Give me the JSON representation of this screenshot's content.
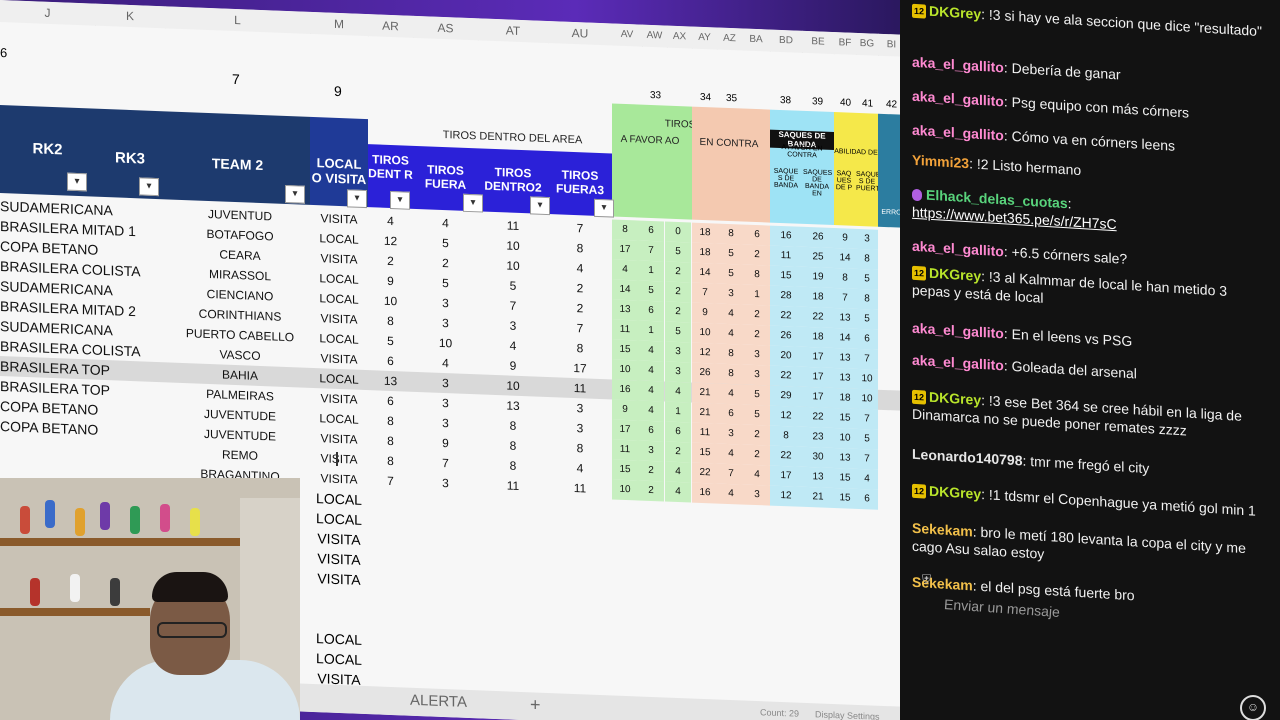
{
  "columns": {
    "J": "J",
    "K": "K",
    "L": "L",
    "M": "M",
    "AR": "AR",
    "AS": "AS",
    "AT": "AT",
    "AU": "AU",
    "AV": "AV",
    "AW": "AW",
    "AX": "AX",
    "AY": "AY",
    "AZ": "AZ",
    "BA": "BA",
    "BD": "BD",
    "BE": "BE",
    "BF": "BF",
    "BG": "BG",
    "BI": "BI"
  },
  "top_values": {
    "left": "6",
    "l": "7",
    "m": "9",
    "av": "33",
    "ay": "34",
    "az": "35",
    "bd": "38",
    "be": "39",
    "bf": "40",
    "bg": "41",
    "bi": "42"
  },
  "headers": {
    "rk2": "RK2",
    "rk3": "RK3",
    "team2": "TEAM 2",
    "local_visita": "LOCAL O VISITA",
    "tiros_dentro_area": "TIROS DENTRO DEL AREA",
    "tiros_dent": "TIROS DENT R",
    "tiros_fuera": "TIROS FUERA",
    "tiros_dentro2": "TIROS DENTRO2",
    "tiros_fuera3": "TIROS FUERA3",
    "tiros": "TIROS",
    "a_favor": "A FAVOR AO",
    "en_contra": "EN CONTRA",
    "saques_banda": "SAQUES DE BANDA",
    "a_favor_contra": "A FAVOR EN CONTRA",
    "habilidad": "ABILIDAD DE",
    "errores": "ERRO",
    "saques_sub": [
      "SAQUE S DE BANDA",
      "SAQUES DE BANDA EN",
      "SAQ UES DE P",
      "SAQUE S DE PUERT"
    ],
    "ti": "TI"
  },
  "rows": [
    {
      "rk2": "SUDAMERICANA",
      "team": "JUVENTUD",
      "lv": "VISITA",
      "a": "4",
      "b": "4",
      "c": "11",
      "d": "7",
      "g": [
        "8",
        "6",
        "0"
      ],
      "p": [
        "18",
        "8",
        "6"
      ],
      "s": [
        "16",
        "26",
        "9",
        "3"
      ]
    },
    {
      "rk2": "BRASILERA MITAD 1",
      "team": "BOTAFOGO",
      "lv": "LOCAL",
      "a": "12",
      "b": "5",
      "c": "10",
      "d": "8",
      "g": [
        "17",
        "7",
        "5"
      ],
      "p": [
        "18",
        "5",
        "2"
      ],
      "s": [
        "11",
        "25",
        "14",
        "8"
      ]
    },
    {
      "rk2": "COPA BETANO",
      "team": "CEARA",
      "lv": "VISITA",
      "a": "2",
      "b": "2",
      "c": "10",
      "d": "4",
      "g": [
        "4",
        "1",
        "2"
      ],
      "p": [
        "14",
        "5",
        "8"
      ],
      "s": [
        "15",
        "19",
        "8",
        "5"
      ]
    },
    {
      "rk2": "BRASILERA COLISTA",
      "team": "MIRASSOL",
      "lv": "LOCAL",
      "a": "9",
      "b": "5",
      "c": "5",
      "d": "2",
      "g": [
        "14",
        "5",
        "2"
      ],
      "p": [
        "7",
        "3",
        "1"
      ],
      "s": [
        "28",
        "18",
        "7",
        "8"
      ]
    },
    {
      "rk2": "SUDAMERICANA",
      "team": "CIENCIANO",
      "lv": "LOCAL",
      "a": "10",
      "b": "3",
      "c": "7",
      "d": "2",
      "g": [
        "13",
        "6",
        "2"
      ],
      "p": [
        "9",
        "4",
        "2"
      ],
      "s": [
        "22",
        "22",
        "13",
        "5"
      ]
    },
    {
      "rk2": "BRASILERA MITAD 2",
      "team": "CORINTHIANS",
      "lv": "VISITA",
      "a": "8",
      "b": "3",
      "c": "3",
      "d": "7",
      "g": [
        "11",
        "1",
        "5"
      ],
      "p": [
        "10",
        "4",
        "2"
      ],
      "s": [
        "26",
        "18",
        "14",
        "6"
      ]
    },
    {
      "rk2": "SUDAMERICANA",
      "team": "PUERTO CABELLO",
      "lv": "LOCAL",
      "a": "5",
      "b": "10",
      "c": "4",
      "d": "8",
      "g": [
        "15",
        "4",
        "3"
      ],
      "p": [
        "12",
        "8",
        "3"
      ],
      "s": [
        "20",
        "17",
        "13",
        "7"
      ]
    },
    {
      "rk2": "BRASILERA COLISTA",
      "team": "VASCO",
      "lv": "VISITA",
      "a": "6",
      "b": "4",
      "c": "9",
      "d": "17",
      "g": [
        "10",
        "4",
        "3"
      ],
      "p": [
        "26",
        "8",
        "3"
      ],
      "s": [
        "22",
        "17",
        "13",
        "10"
      ]
    },
    {
      "rk2": "BRASILERA TOP",
      "team": "BAHIA",
      "lv": "LOCAL",
      "a": "13",
      "b": "3",
      "c": "10",
      "d": "11",
      "g": [
        "16",
        "4",
        "4"
      ],
      "p": [
        "21",
        "4",
        "5"
      ],
      "s": [
        "29",
        "17",
        "18",
        "10"
      ],
      "hl": true
    },
    {
      "rk2": "BRASILERA TOP",
      "team": "PALMEIRAS",
      "lv": "VISITA",
      "a": "6",
      "b": "3",
      "c": "13",
      "d": "3",
      "g": [
        "9",
        "4",
        "1"
      ],
      "p": [
        "21",
        "6",
        "5"
      ],
      "s": [
        "12",
        "22",
        "15",
        "7"
      ]
    },
    {
      "rk2": "COPA BETANO",
      "team": "JUVENTUDE",
      "lv": "LOCAL",
      "a": "8",
      "b": "3",
      "c": "8",
      "d": "3",
      "g": [
        "17",
        "6",
        "6"
      ],
      "p": [
        "11",
        "3",
        "2"
      ],
      "s": [
        "8",
        "23",
        "10",
        "5"
      ]
    },
    {
      "rk2": "COPA BETANO",
      "team": "JUVENTUDE",
      "lv": "VISITA",
      "a": "8",
      "b": "9",
      "c": "8",
      "d": "8",
      "g": [
        "11",
        "3",
        "2"
      ],
      "p": [
        "15",
        "4",
        "2"
      ],
      "s": [
        "22",
        "30",
        "13",
        "7"
      ]
    },
    {
      "rk2": "",
      "team": "REMO",
      "lv": "VISITA",
      "a": "8",
      "b": "7",
      "c": "8",
      "d": "4",
      "g": [
        "15",
        "2",
        "4"
      ],
      "p": [
        "22",
        "7",
        "4"
      ],
      "s": [
        "17",
        "13",
        "15",
        "4"
      ]
    },
    {
      "rk2": "",
      "team": "BRAGANTINO",
      "lv": "VISITA",
      "a": "7",
      "b": "3",
      "c": "11",
      "d": "11",
      "g": [
        "10",
        "2",
        "4"
      ],
      "p": [
        "16",
        "4",
        "3"
      ],
      "s": [
        "12",
        "21",
        "15",
        "6"
      ]
    }
  ],
  "extra_lv": [
    "LOCAL",
    "LOCAL",
    "VISITA",
    "VISITA",
    "VISITA",
    "",
    "",
    "LOCAL",
    "LOCAL",
    "VISITA",
    "LOCAL",
    "VISITA",
    "VISITA"
  ],
  "sheet_tab": "ALERTA",
  "status": {
    "count": "Count: 29",
    "display": "Display Settings"
  },
  "chat": {
    "messages": [
      {
        "user": "DKGrey",
        "badge": "12",
        "color": "#b9e52b",
        "text": "!3 si hay ve ala seccion que dice \"resultado\""
      },
      {
        "user": "aka_el_gallito",
        "color": "#ff8ad2",
        "text": "Debería de ganar"
      },
      {
        "user": "aka_el_gallito",
        "color": "#ff8ad2",
        "text": "Psg equipo con más córners"
      },
      {
        "user": "aka_el_gallito",
        "color": "#ff8ad2",
        "text": "Cómo va en córners leens"
      },
      {
        "user": "Yimmi23",
        "color": "#f2a23a",
        "text": "!2 Listo hermano"
      },
      {
        "user": "Elhack_delas_cuotas",
        "color": "#59d47c",
        "text": "https://www.bet365.pe/s/r/ZH7sC",
        "mic": true
      },
      {
        "user": "aka_el_gallito",
        "color": "#ff8ad2",
        "text": "+6.5 córners sale?"
      },
      {
        "user": "DKGrey",
        "badge": "12",
        "color": "#b9e52b",
        "text": "!3 al Kalmmar de local le han metido 3 pepas y está de local"
      },
      {
        "user": "aka_el_gallito",
        "color": "#ff8ad2",
        "text": "En el leens vs PSG"
      },
      {
        "user": "aka_el_gallito",
        "color": "#ff8ad2",
        "text": "Goleada del arsenal"
      },
      {
        "user": "DKGrey",
        "badge": "12",
        "color": "#b9e52b",
        "text": "!3 ese Bet 364 se cree hábil en la liga de Dinamarca no se puede poner remates zzzz"
      },
      {
        "user": "Leonardo140798",
        "color": "#e6e6e6",
        "text": "tmr me fregó el city"
      },
      {
        "user": "DKGrey",
        "badge": "12",
        "color": "#b9e52b",
        "text": "!1 tdsmr el Copenhague ya metió gol min 1"
      },
      {
        "user": "Sekekam",
        "color": "#f2c04a",
        "text": "bro le metí 180 levanta la copa el city y me cago Asu salao estoy"
      },
      {
        "user": "Sekekam",
        "color": "#f2c04a",
        "text": "el del psg está fuerte bro"
      }
    ],
    "input_placeholder": "Enviar un mensaje"
  }
}
